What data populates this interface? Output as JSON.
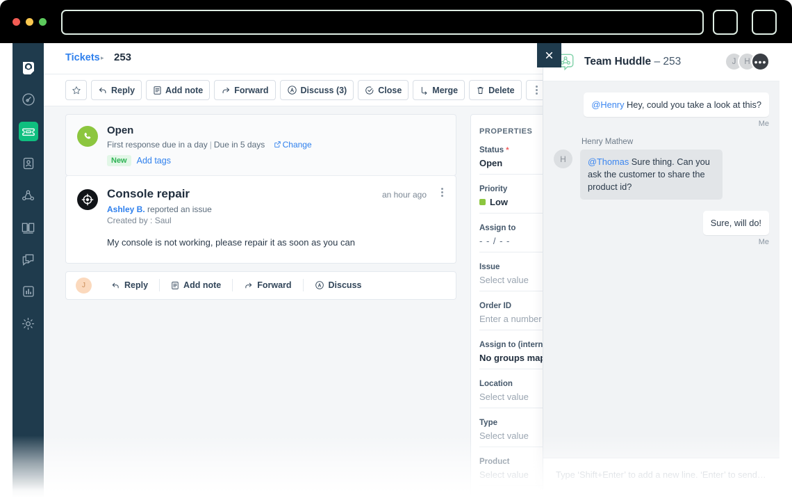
{
  "browser": {
    "dots": [
      "red",
      "yellow",
      "green"
    ],
    "url_value": "",
    "url_placeholder": ""
  },
  "sidebar": {
    "items": [
      {
        "icon": "headset-logo-icon",
        "label": "Freshdesk",
        "active": false
      },
      {
        "icon": "dashboard-gauge-icon",
        "label": "Dashboard",
        "active": false
      },
      {
        "icon": "ticket-icon",
        "label": "Tickets",
        "active": true
      },
      {
        "icon": "contacts-icon",
        "label": "Contacts",
        "active": false
      },
      {
        "icon": "team-huddle-icon",
        "label": "Team Huddle",
        "active": false
      },
      {
        "icon": "knowledge-base-icon",
        "label": "Solutions",
        "active": false
      },
      {
        "icon": "chat-icon",
        "label": "Chat",
        "active": false
      },
      {
        "icon": "reports-bar-icon",
        "label": "Reports",
        "active": false
      },
      {
        "icon": "gear-icon",
        "label": "Admin",
        "active": false
      }
    ]
  },
  "topbar": {
    "breadcrumb_root": "Tickets",
    "breadcrumb_separator": "▸",
    "breadcrumb_id": "253"
  },
  "toolbar": {
    "star_label": "Favorite",
    "buttons": [
      {
        "icon": "reply-icon",
        "label": "Reply"
      },
      {
        "icon": "note-icon",
        "label": "Add note"
      },
      {
        "icon": "forward-icon",
        "label": "Forward"
      },
      {
        "icon": "discuss-icon",
        "label": "Discuss (3)"
      },
      {
        "icon": "close-check-icon",
        "label": "Close"
      },
      {
        "icon": "merge-icon",
        "label": "Merge"
      },
      {
        "icon": "trash-icon",
        "label": "Delete"
      }
    ],
    "more_label": "More"
  },
  "ticket": {
    "status_icon": "phone-icon",
    "status_title": "Open",
    "first_response": "First response due in a day",
    "separator": "|",
    "due": "Due in 5 days",
    "change_label": "Change",
    "change_icon": "external-link-icon",
    "tag": "New",
    "add_tags_label": "Add tags",
    "avatar_icon": "target-crosshair-icon",
    "subject": "Console repair",
    "reporter": "Ashley B.",
    "reported_text": "reported an issue",
    "created_by": "Created by : Saul",
    "timestamp": "an hour ago",
    "description": "My console is not working, please repair it as soon as you can",
    "kebab_label": "More options"
  },
  "reply_bar": {
    "avatar_initial": "J",
    "actions": [
      {
        "icon": "reply-icon",
        "label": "Reply"
      },
      {
        "icon": "note-icon",
        "label": "Add note"
      },
      {
        "icon": "forward-icon",
        "label": "Forward"
      },
      {
        "icon": "discuss-icon",
        "label": "Discuss"
      }
    ]
  },
  "properties": {
    "header": "PROPERTIES",
    "fields": [
      {
        "label": "Status",
        "required": true,
        "value": "Open",
        "style": "value"
      },
      {
        "label": "Priority",
        "required": false,
        "value": "Low",
        "style": "priority",
        "color": "#8cc63f"
      },
      {
        "label": "Assign to",
        "required": false,
        "value": "- - / - -",
        "style": "dash"
      },
      {
        "label": "Issue",
        "required": false,
        "value": "Select value",
        "style": "muted"
      },
      {
        "label": "Order ID",
        "required": false,
        "value": "Enter a number",
        "style": "muted"
      },
      {
        "label": "Assign to (internal)",
        "required": false,
        "value": "No groups mapped for",
        "style": "value"
      },
      {
        "label": "Location",
        "required": false,
        "value": "Select value",
        "style": "muted"
      },
      {
        "label": "Type",
        "required": false,
        "value": "Select value",
        "style": "muted"
      },
      {
        "label": "Product",
        "required": false,
        "value": "Select value",
        "style": "muted"
      }
    ]
  },
  "close_button": {
    "icon": "close-x-icon",
    "label": "Close panel"
  },
  "huddle": {
    "icon": "team-huddle-icon",
    "title": "Team Huddle",
    "ticket_ref": "– 253",
    "avatars": [
      {
        "initial": "J",
        "style": "g1"
      },
      {
        "initial": "H",
        "style": "g2"
      },
      {
        "initial": "•••",
        "style": "dark"
      }
    ],
    "messages": [
      {
        "direction": "out",
        "mention": "@Henry",
        "text": " Hey, could you take a look at this?",
        "meta": "Me"
      },
      {
        "direction": "in",
        "sender": "Henry Mathew",
        "avatar": "H",
        "mention": "@Thomas",
        "text": " Sure thing. Can you ask the customer to share the product id?"
      },
      {
        "direction": "out",
        "mention": "",
        "text": "Sure, will do!",
        "meta": "Me"
      }
    ],
    "input_placeholder": "Type ‘Shift+Enter’ to add a new line. ‘Enter’ to send…"
  },
  "colors": {
    "accent_green": "#0fbf7f",
    "sidebar_navy": "#1f3b4d",
    "link_blue": "#2f80ed",
    "tag_green": "#2eb354",
    "priority_low": "#8cc63f"
  }
}
